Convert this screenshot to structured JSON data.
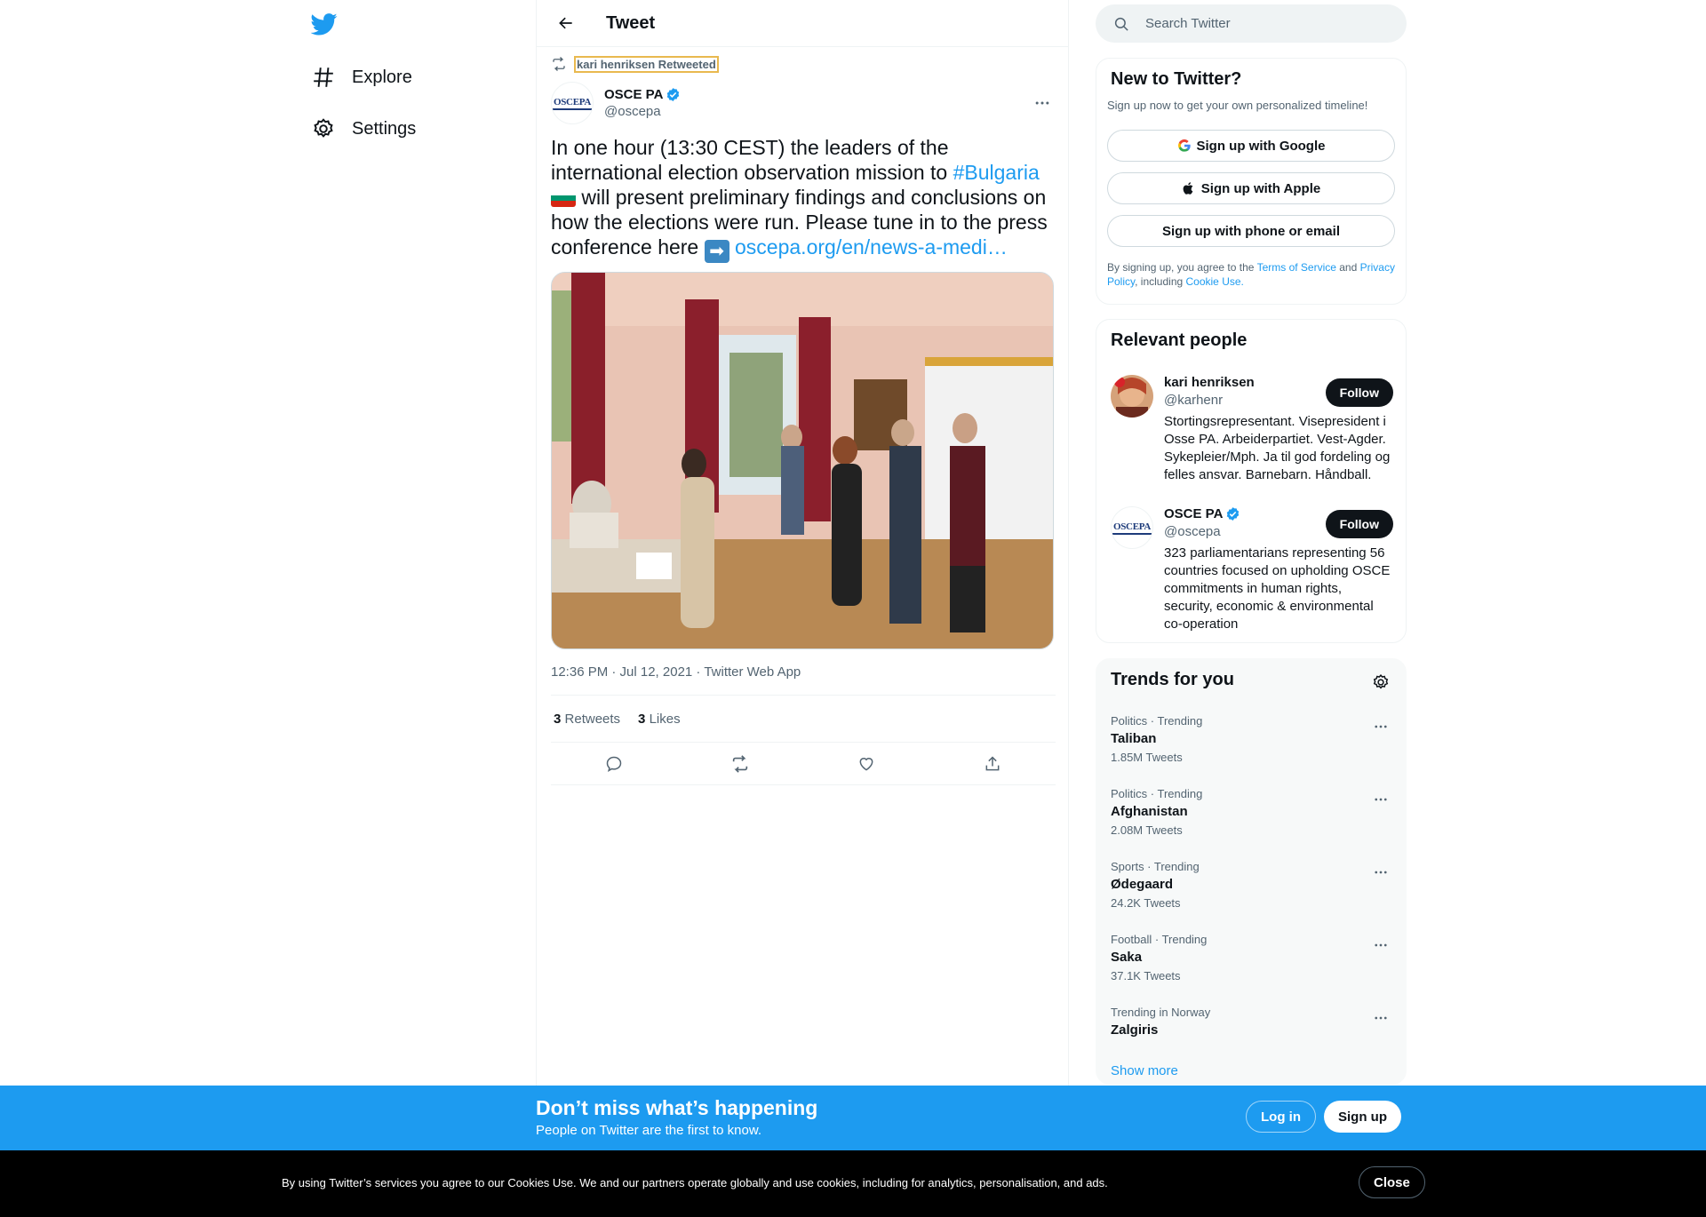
{
  "nav": {
    "items": [
      {
        "label": "Explore",
        "icon": "hashtag-icon"
      },
      {
        "label": "Settings",
        "icon": "gear-icon"
      }
    ]
  },
  "header": {
    "title": "Tweet"
  },
  "tweet": {
    "retweeted_by": "kari henriksen Retweeted",
    "author_name": "OSCE PA",
    "author_handle": "@oscepa",
    "avatar_text": "OSCEPA",
    "text_part1": "In one hour (13:30 CEST) the leaders of the international election observation mission to ",
    "hashtag": "#Bulgaria",
    "text_part2": " will present preliminary findings and conclusions on how the elections were run. Please tune in to the press conference here ",
    "link": "oscepa.org/en/news-a-medi…",
    "meta": "12:36 PM · Jul 12, 2021 · Twitter Web App",
    "retweets_count": "3",
    "retweets_label": "Retweets",
    "likes_count": "3",
    "likes_label": "Likes"
  },
  "search": {
    "placeholder": "Search Twitter"
  },
  "signup_panel": {
    "title": "New to Twitter?",
    "subtitle": "Sign up now to get your own personalized timeline!",
    "google": "Sign up with Google",
    "apple": "Sign up with Apple",
    "phone": "Sign up with phone or email",
    "legal_1": "By signing up, you agree to the ",
    "terms": "Terms of Service",
    "legal_2": " and ",
    "privacy": "Privacy Policy",
    "legal_3": ", including ",
    "cookie": "Cookie Use."
  },
  "people_panel": {
    "title": "Relevant people",
    "people": [
      {
        "name": "kari henriksen",
        "handle": "@karhenr",
        "bio": "Stortingsrepresentant. Visepresident i Osse PA. Arbeiderpartiet. Vest-Agder. Sykepleier/Mph. Ja til god fordeling og felles ansvar. Barnebarn. Håndball.",
        "follow": "Follow"
      },
      {
        "name": "OSCE PA",
        "handle": "@oscepa",
        "bio": "323 parliamentarians representing 56 countries focused on upholding OSCE commitments in human rights, security, economic & environmental co-operation",
        "follow": "Follow"
      }
    ]
  },
  "trends_panel": {
    "title": "Trends for you",
    "trends": [
      {
        "category": "Politics · Trending",
        "name": "Taliban",
        "count": "1.85M Tweets"
      },
      {
        "category": "Politics · Trending",
        "name": "Afghanistan",
        "count": "2.08M Tweets"
      },
      {
        "category": "Sports · Trending",
        "name": "Ødegaard",
        "count": "24.2K Tweets"
      },
      {
        "category": "Football · Trending",
        "name": "Saka",
        "count": "37.1K Tweets"
      },
      {
        "category": "Trending in Norway",
        "name": "Zalgiris",
        "count": ""
      }
    ],
    "show_more": "Show more"
  },
  "bottom_bar": {
    "title": "Don’t miss what’s happening",
    "subtitle": "People on Twitter are the first to know.",
    "login": "Log in",
    "signup": "Sign up"
  },
  "cookie_bar": {
    "text": "By using Twitter’s services you agree to our Cookies Use. We and our partners operate globally and use cookies, including for analytics, personalisation, and ads.",
    "close": "Close"
  },
  "colors": {
    "brand": "#1d9bf0",
    "text": "#0f1419",
    "muted": "#536471",
    "border": "#eff3f4"
  }
}
